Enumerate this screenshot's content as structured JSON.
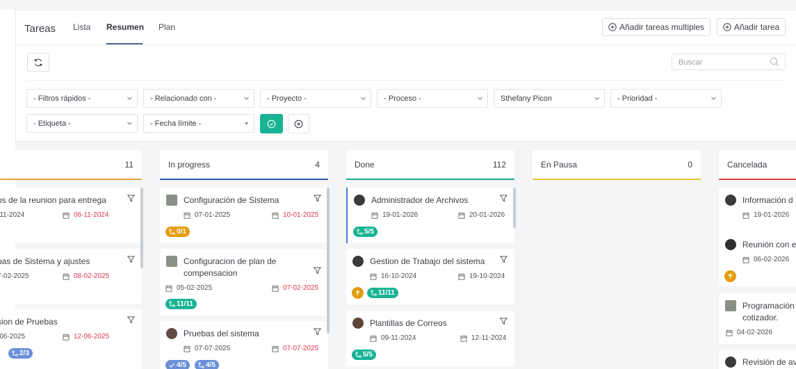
{
  "header": {
    "title": "Tareas",
    "tabs": [
      {
        "label": "Lista"
      },
      {
        "label": "Resumen"
      },
      {
        "label": "Plan"
      }
    ],
    "add_multiple": "Añadir tareas multiples",
    "add_task": "Añadir tarea"
  },
  "search": {
    "placeholder": "Buscar"
  },
  "filters": {
    "quick": "- Filtros rápidos -",
    "related": "- Relacionado con -",
    "project": "- Proyecto -",
    "process": "- Proceso -",
    "user": "Sthefany Picon",
    "priority": "- Prioridad -",
    "tag": "- Etiqueta -",
    "due": "- Fecha límite -"
  },
  "colors": {
    "accent": "#19b394",
    "due_red": "#e0364f",
    "bar_orange": "#e8a33a",
    "bar_blue": "#2e5aa6",
    "bar_teal": "#1aa88a",
    "bar_yellow": "#e6c02a",
    "bar_red": "#d94040",
    "pill_green": "#19b394",
    "pill_orange": "#e39d12",
    "pill_blue": "#6a8fd8"
  },
  "columns": [
    {
      "name": "",
      "count": "11",
      "cards": [
        {
          "title": "os de la reunion para entrega",
          "start": "-11-2024",
          "due": "06-11-2024"
        },
        {
          "title": "pas de Sistema y ajustes",
          "start": "7-02-2025",
          "due": "08-02-2025"
        },
        {
          "title": "sion de Pruebas",
          "start": "-06-2025",
          "due": "12-06-2025",
          "pill": "2/3"
        }
      ]
    },
    {
      "name": "In progress",
      "count": "4",
      "cards": [
        {
          "title": "Configuración de Sistema",
          "start": "07-01-2025",
          "due": "10-01-2025",
          "pill": "0/1"
        },
        {
          "title": "Configuracion de plan de compensacion",
          "start": "05-02-2025",
          "due": "07-02-2025",
          "pill": "11/11"
        },
        {
          "title": "Pruebas del sistema",
          "start": "07-07-2025",
          "due": "07-07-2025",
          "pill": "4/5",
          "pill2": "4/5"
        }
      ]
    },
    {
      "name": "Done",
      "count": "112",
      "cards": [
        {
          "title": "Administrador de Archivos",
          "start": "19-01-2026",
          "due": "20-01-2026",
          "pill": "5/5"
        },
        {
          "title": "Gestion de Trabajo del sistema",
          "start": "16-10-2024",
          "due": "19-10-2024",
          "pill": "11/11"
        },
        {
          "title": "Plantillas de Correos",
          "start": "09-11-2024",
          "due": "12-11-2024",
          "pill": "5/5"
        }
      ]
    },
    {
      "name": "En Pausa",
      "count": "0",
      "cards": []
    },
    {
      "name": "Cancelada",
      "count": "",
      "cards": [
        {
          "title": "Información d",
          "start": "19-01-2026"
        },
        {
          "title": "Reunión con e",
          "start": "06-02-2026"
        },
        {
          "title": "Programación cotizador.",
          "start": "04-02-2026"
        },
        {
          "title": "Revisión de av"
        }
      ]
    }
  ]
}
